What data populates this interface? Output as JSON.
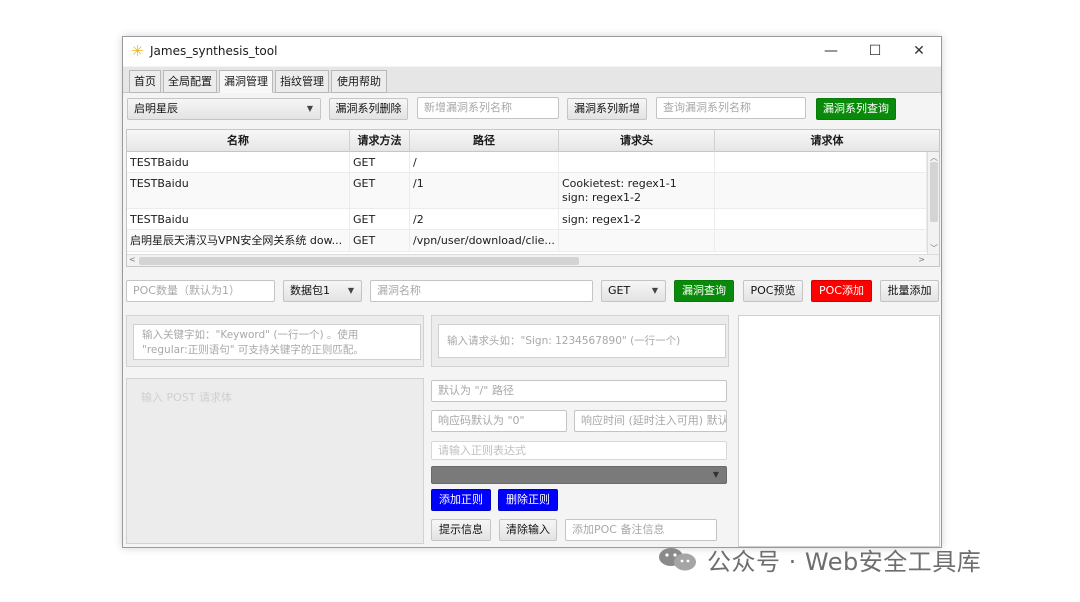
{
  "window": {
    "title": "James_synthesis_tool",
    "controls": {
      "minimize": "—",
      "maximize": "☐",
      "close": "✕"
    }
  },
  "tabs": [
    {
      "label": "首页"
    },
    {
      "label": "全局配置"
    },
    {
      "label": "漏洞管理"
    },
    {
      "label": "指纹管理"
    },
    {
      "label": "使用帮助"
    }
  ],
  "toolbar": {
    "series_select": "启明星辰",
    "delete_series": "漏洞系列删除",
    "new_series_placeholder": "新增漏洞系列名称",
    "add_series": "漏洞系列新增",
    "search_series_placeholder": "查询漏洞系列名称",
    "query_series": "漏洞系列查询"
  },
  "table": {
    "columns": [
      "名称",
      "请求方法",
      "路径",
      "请求头",
      "请求体"
    ],
    "rows": [
      {
        "name": "TESTBaidu",
        "method": "GET",
        "path": "/",
        "header1": "",
        "header2": "",
        "body": ""
      },
      {
        "name": "TESTBaidu",
        "method": "GET",
        "path": "/1",
        "header1": "Cookietest: regex1-1",
        "header2": "sign: regex1-2",
        "body": ""
      },
      {
        "name": "TESTBaidu",
        "method": "GET",
        "path": "/2",
        "header1": "sign: regex1-2",
        "header2": "",
        "body": ""
      },
      {
        "name": "启明星辰天清汉马VPN安全网关系统 dow...",
        "method": "GET",
        "path": "/vpn/user/download/clie...",
        "header1": "",
        "header2": "",
        "body": ""
      }
    ]
  },
  "poc_bar": {
    "count_placeholder": "POC数量（默认为1）",
    "packet_select": "数据包1",
    "vuln_name_placeholder": "漏洞名称",
    "method_select": "GET",
    "query_vuln": "漏洞查询",
    "preview": "POC预览",
    "add_poc": "POC添加",
    "batch_add": "批量添加"
  },
  "form": {
    "keyword_placeholder_1": "输入关键字如：\"Keyword\" (一行一个) 。使用",
    "keyword_placeholder_2": "\"regular:正则语句\" 可支持关键字的正则匹配。",
    "header_placeholder": "输入请求头如：\"Sign: 1234567890\" (一行一个)",
    "post_body_placeholder": "输入 POST 请求体",
    "path_placeholder": "默认为 \"/\" 路径",
    "status_placeholder": "响应码默认为 \"0\"",
    "response_time_placeholder": "响应时间 (延时注入可用) 默认",
    "regex_placeholder": "请输入正则表达式",
    "add_regex": "添加正则",
    "delete_regex": "删除正则",
    "hint": "提示信息",
    "clear_input": "清除输入",
    "remark_placeholder": "添加POC 备注信息"
  },
  "watermark": "公众号 · Web安全工具库"
}
